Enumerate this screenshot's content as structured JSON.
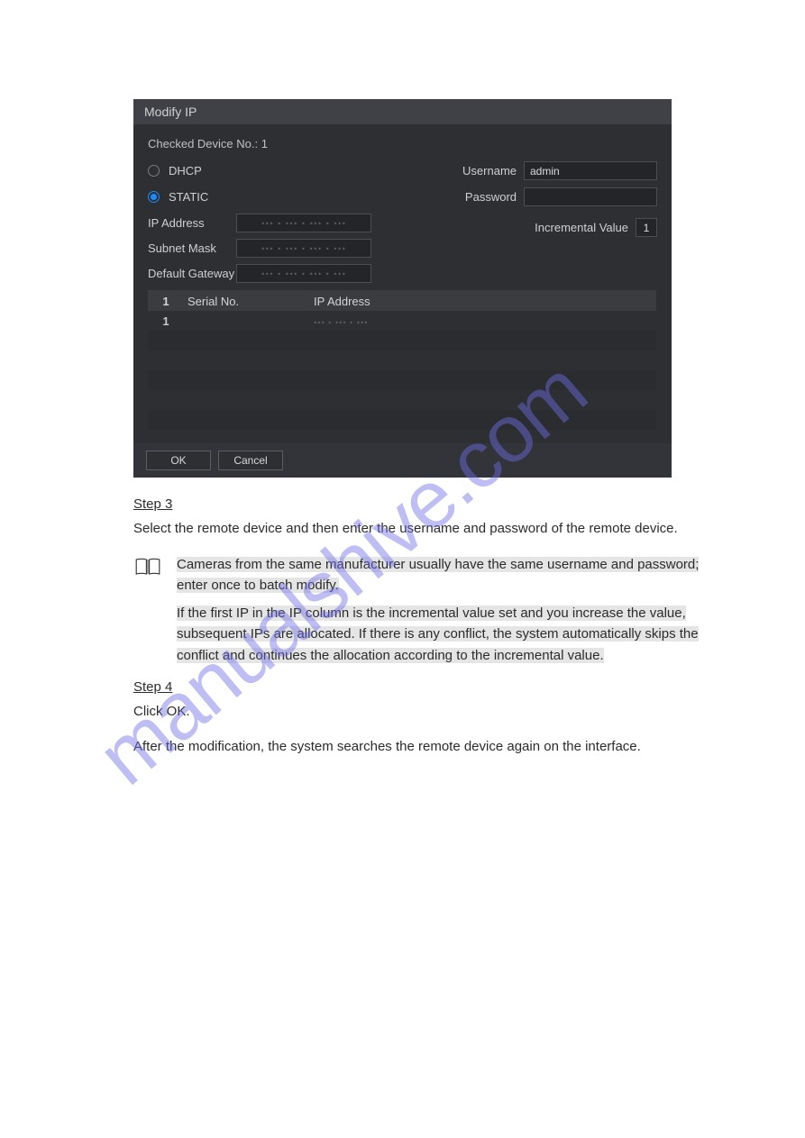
{
  "watermark": "manualshive.com",
  "dialog": {
    "title": "Modify IP",
    "checked_device_label": "Checked Device No.: 1",
    "options": {
      "dhcp": {
        "label": "DHCP",
        "checked": false
      },
      "static": {
        "label": "STATIC",
        "checked": true
      }
    },
    "credentials": {
      "username_label": "Username",
      "username_value": "admin",
      "password_label": "Password",
      "password_value": ""
    },
    "network": {
      "ip_address_label": "IP Address",
      "ip_address_value": "··· · ··· · ··· · ···",
      "subnet_mask_label": "Subnet Mask",
      "subnet_mask_value": "··· · ··· · ··· · ···",
      "default_gateway_label": "Default Gateway",
      "default_gateway_value": "··· · ··· · ··· · ···"
    },
    "incremental": {
      "label": "Incremental Value",
      "value": "1"
    },
    "table": {
      "columns": {
        "idx": "1",
        "serial": "Serial No.",
        "ip": "IP Address"
      },
      "rows": [
        {
          "idx": "1",
          "serial": "",
          "ip": "··· · ··· · ···"
        }
      ]
    },
    "buttons": {
      "ok": "OK",
      "cancel": "Cancel"
    }
  },
  "doc": {
    "step3_label": "Step 3",
    "step3_body": "Select the remote device and then enter the username and password of the remote device.",
    "note": {
      "line1": "Cameras from the same manufacturer usually have the same username and password; ",
      "hl1": "enter once to batch modify.",
      "line2": "If the first IP in the ",
      "hl2": "IP column is the incremental value set",
      "line3": " and you increase the value, subsequent IPs are allocated. If there is any conflict, the system automatically skips the conflict and continues the allocation according to the incremental value."
    },
    "step4_label": "Step 4",
    "step4_body": "Click OK.",
    "after": "After the modification, the system searches the remote device again on the interface."
  }
}
